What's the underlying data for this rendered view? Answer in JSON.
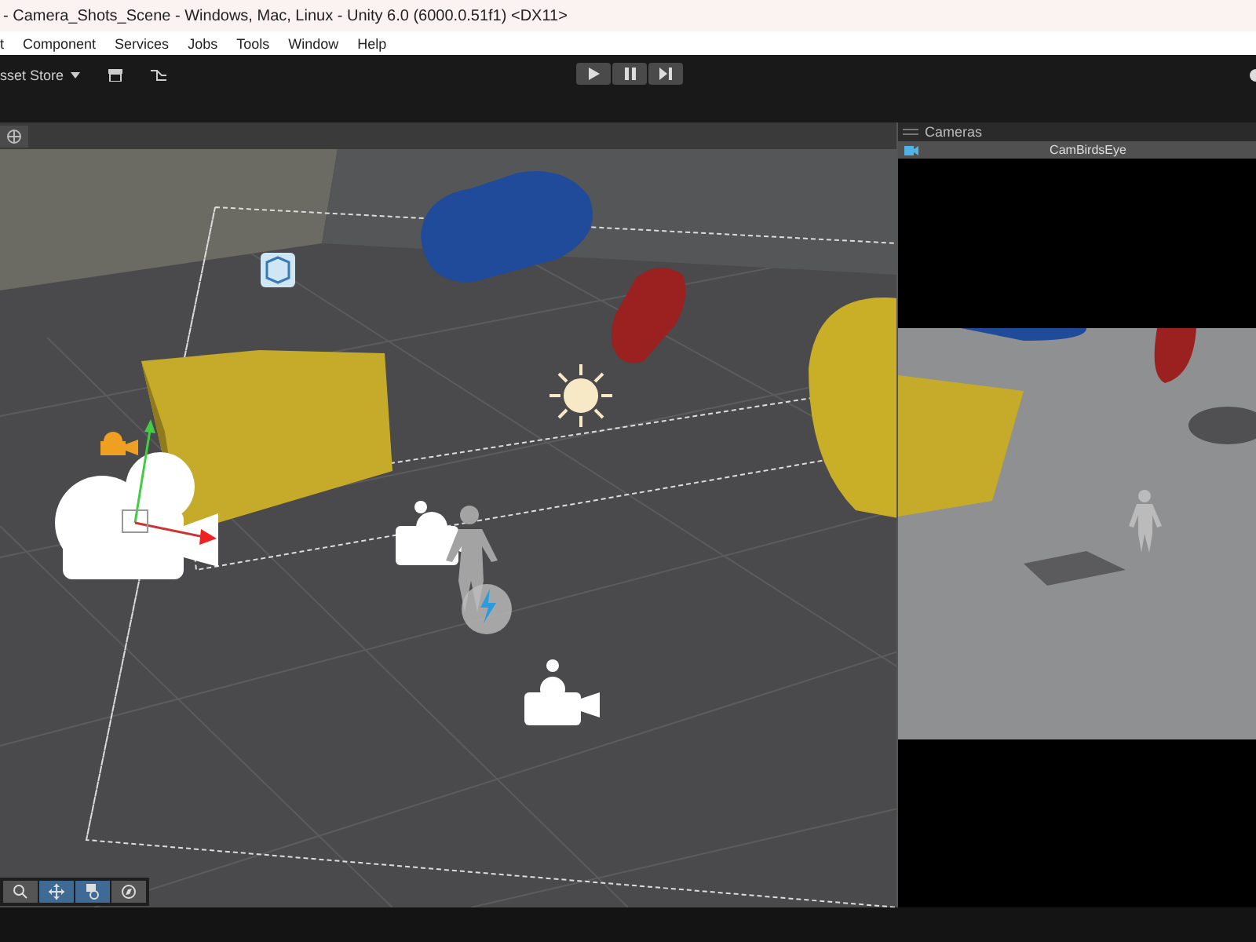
{
  "window": {
    "title": "- Camera_Shots_Scene - Windows, Mac, Linux - Unity 6.0 (6000.0.51f1) <DX11>"
  },
  "menu": [
    "t",
    "Component",
    "Services",
    "Jobs",
    "Tools",
    "Window",
    "Help"
  ],
  "toolbar": {
    "asset_store": "sset Store"
  },
  "scene_tools": [
    {
      "kind": "search",
      "selected": false
    },
    {
      "kind": "move",
      "selected": true
    },
    {
      "kind": "layers",
      "selected": true
    },
    {
      "kind": "compass",
      "selected": false
    }
  ],
  "cameras_panel": {
    "title": "Cameras",
    "camera": "CamBirdsEye"
  }
}
